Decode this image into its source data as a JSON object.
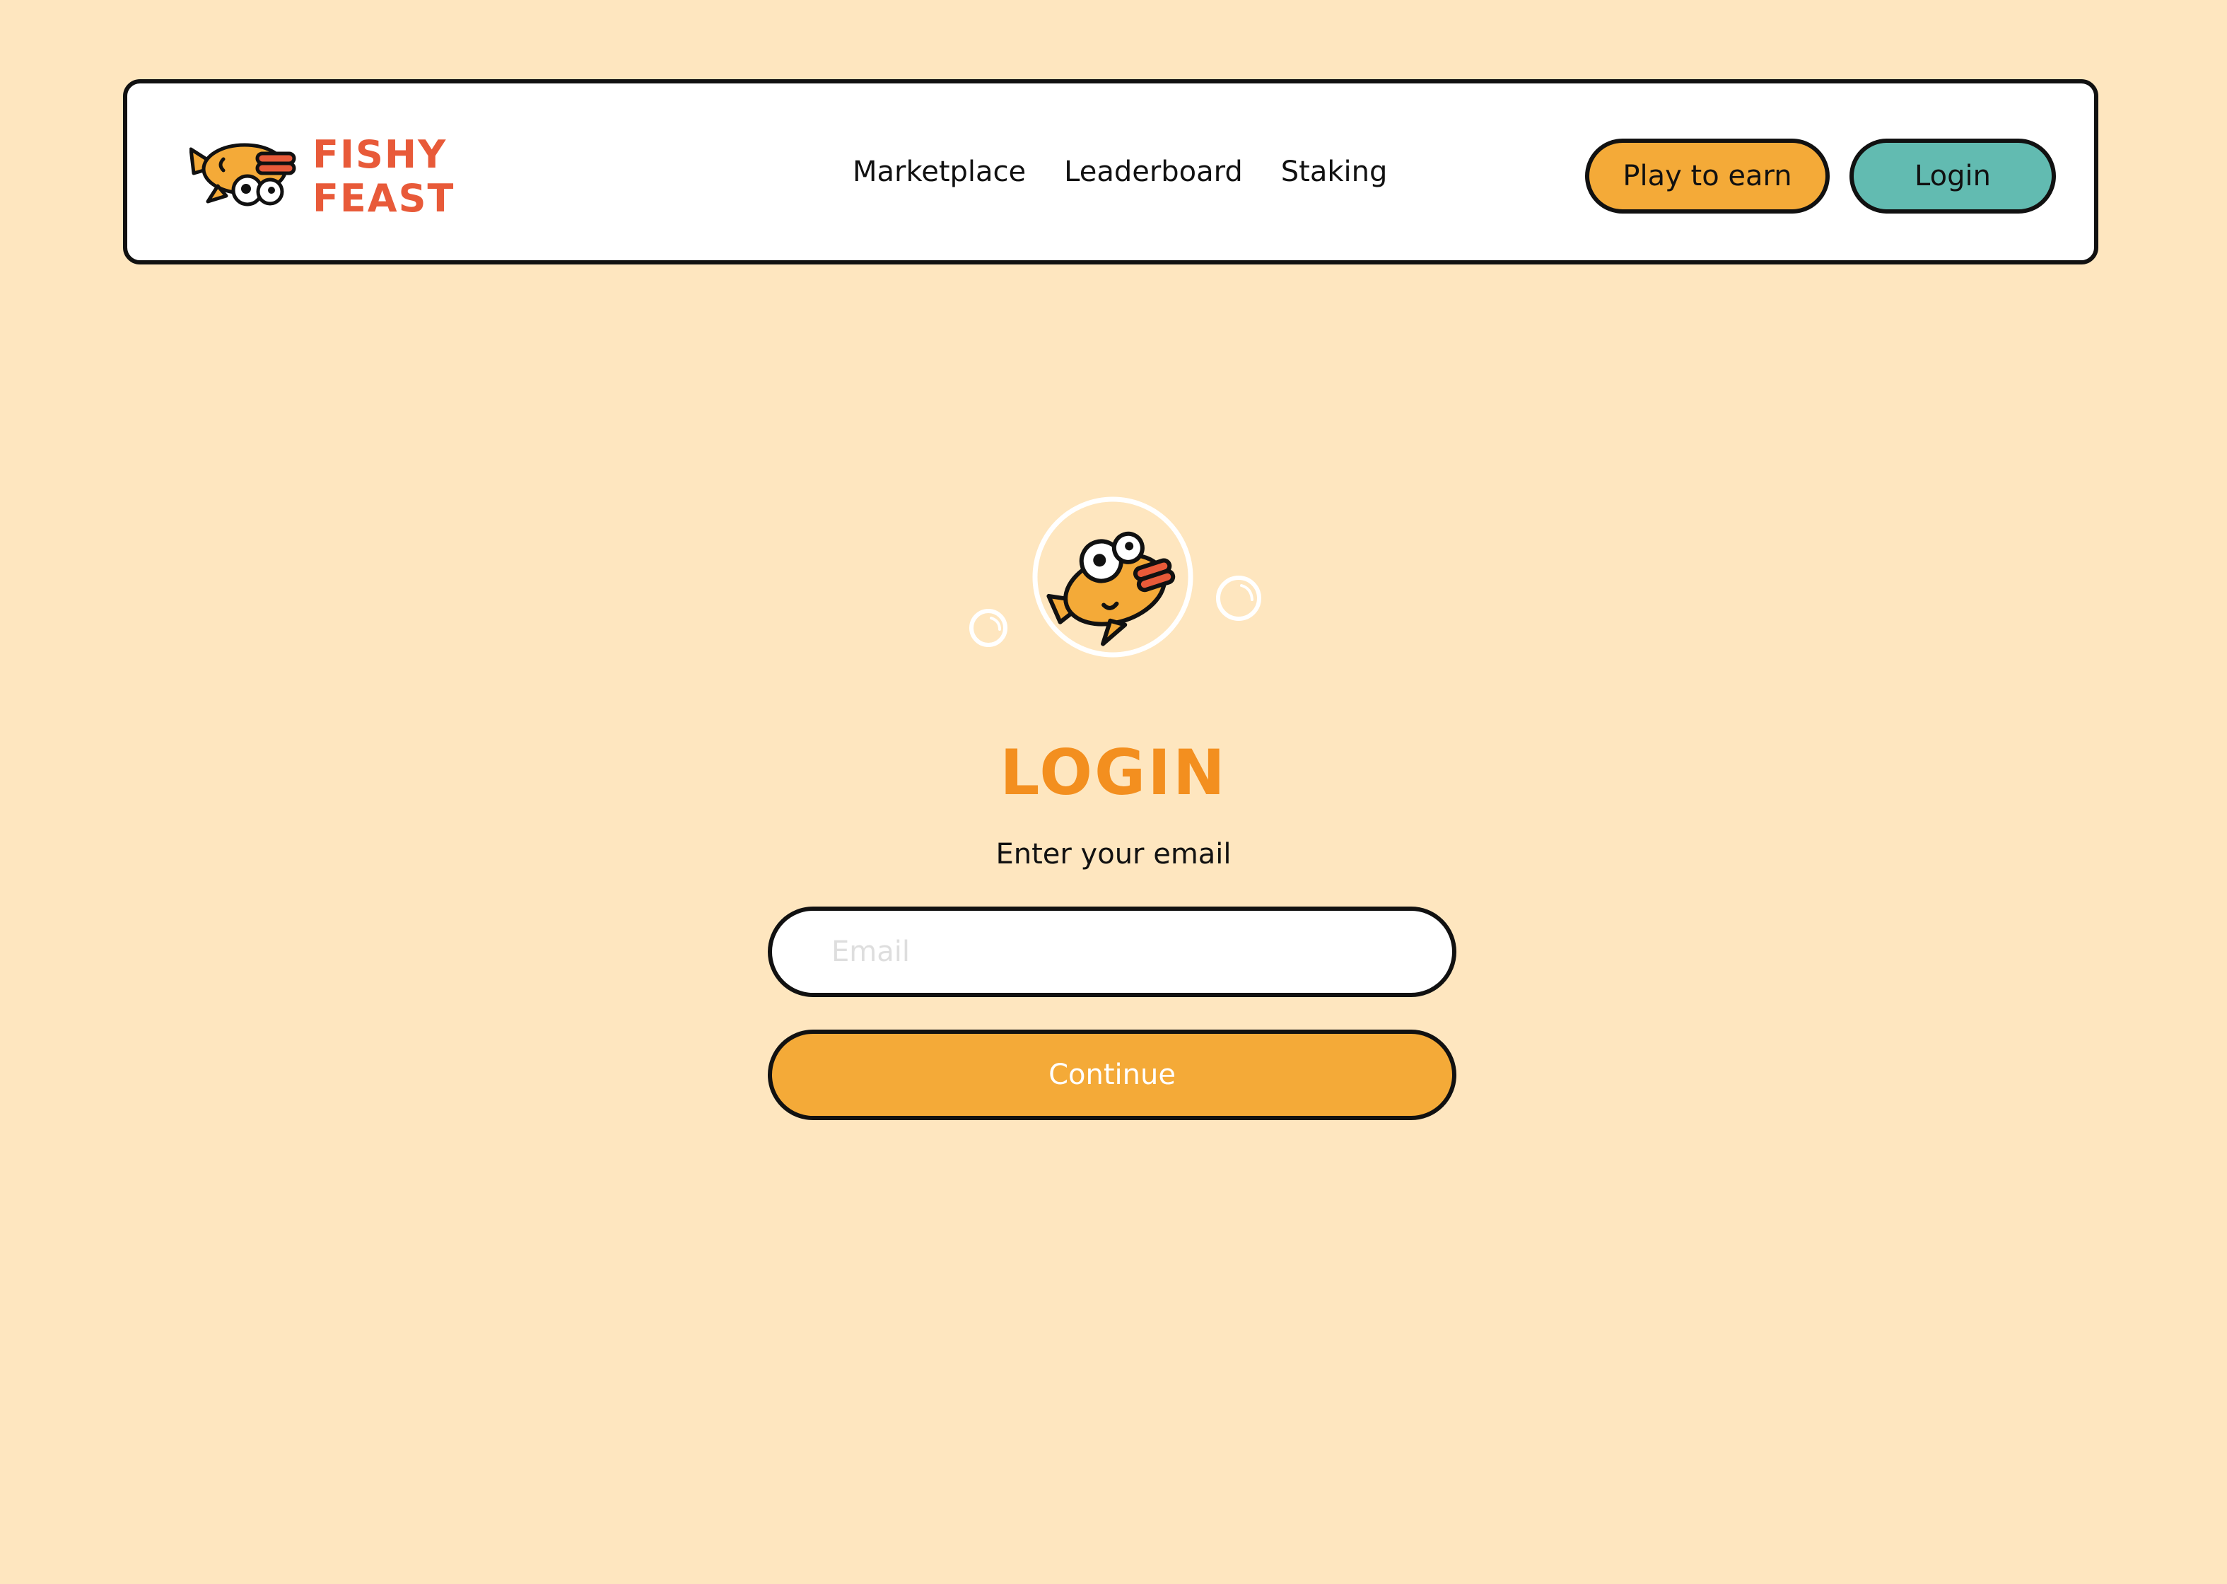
{
  "brand": {
    "name_line1": "FISHY",
    "name_line2": "FEAST",
    "logo_icon": "fish-icon",
    "color": "#e85a39"
  },
  "nav": {
    "links": [
      {
        "label": "Marketplace"
      },
      {
        "label": "Leaderboard"
      },
      {
        "label": "Staking"
      }
    ],
    "play_button": {
      "label": "Play to earn",
      "color": "#f4aa38"
    },
    "login_button": {
      "label": "Login",
      "color": "#62bbb1"
    }
  },
  "login": {
    "hero_icon": "fish-in-bubble-icon",
    "title": "LOGIN",
    "title_color": "#f38f1f",
    "email_label": "Enter your email",
    "email_value": "",
    "email_placeholder": "Email",
    "continue_label": "Continue"
  },
  "colors": {
    "background": "#fee6bf",
    "accent_orange": "#f4aa38",
    "accent_teal": "#62bbb1"
  }
}
